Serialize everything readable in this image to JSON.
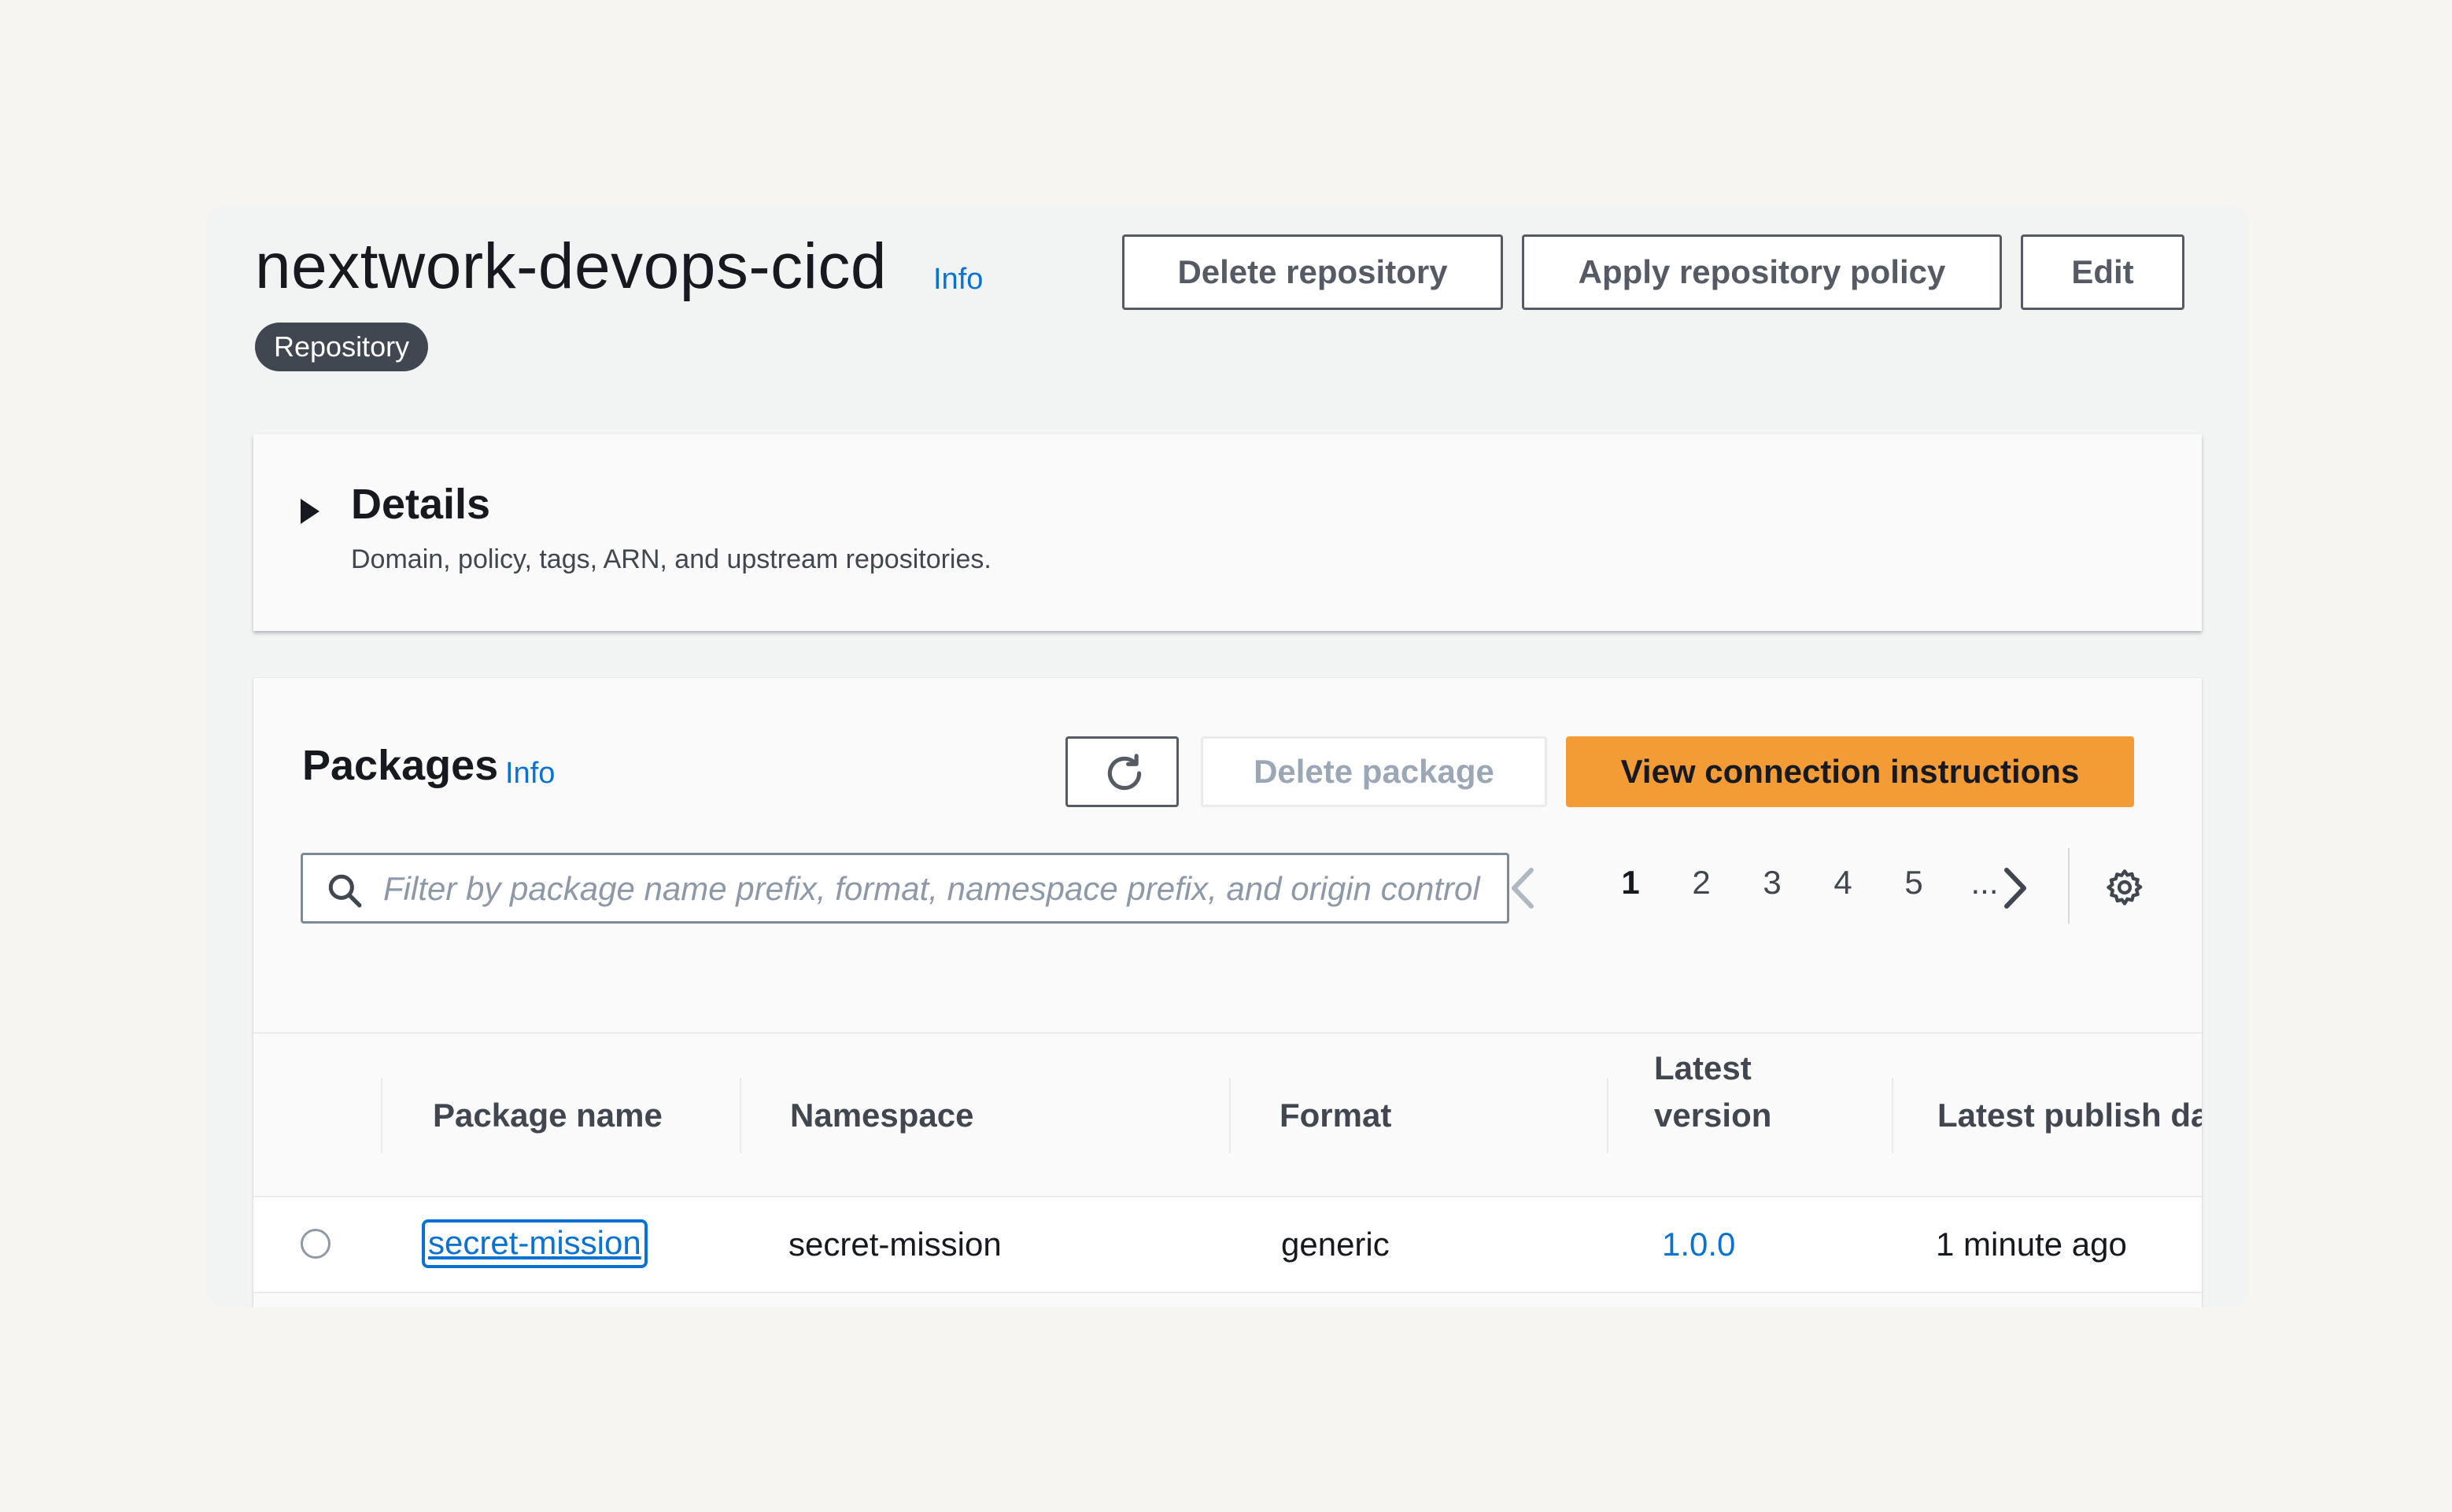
{
  "header": {
    "title": "nextwork-devops-cicd",
    "info_label": "Info",
    "badge": "Repository",
    "buttons": {
      "delete_repository": "Delete repository",
      "apply_policy": "Apply repository policy",
      "edit": "Edit"
    }
  },
  "details": {
    "title": "Details",
    "description": "Domain, policy, tags, ARN, and upstream repositories."
  },
  "packages": {
    "title": "Packages",
    "info_label": "Info",
    "delete_package": "Delete package",
    "view_connection": "View connection instructions",
    "search_placeholder": "Filter by package name prefix, format, namespace prefix, and origin control",
    "pagination": {
      "pages": [
        "1",
        "2",
        "3",
        "4",
        "5",
        "..."
      ],
      "current": "1"
    },
    "columns": {
      "package_name": "Package name",
      "namespace": "Namespace",
      "format": "Format",
      "latest_version_line1": "Latest",
      "latest_version_line2": "version",
      "latest_publish": "Latest publish da"
    },
    "rows": [
      {
        "package_name": "secret-mission",
        "namespace": "secret-mission",
        "format": "generic",
        "latest_version": "1.0.0",
        "latest_publish": "1 minute ago"
      }
    ]
  },
  "colors": {
    "accent_orange": "#f39c35",
    "link_blue": "#0972d3",
    "badge_bg": "#414750"
  }
}
